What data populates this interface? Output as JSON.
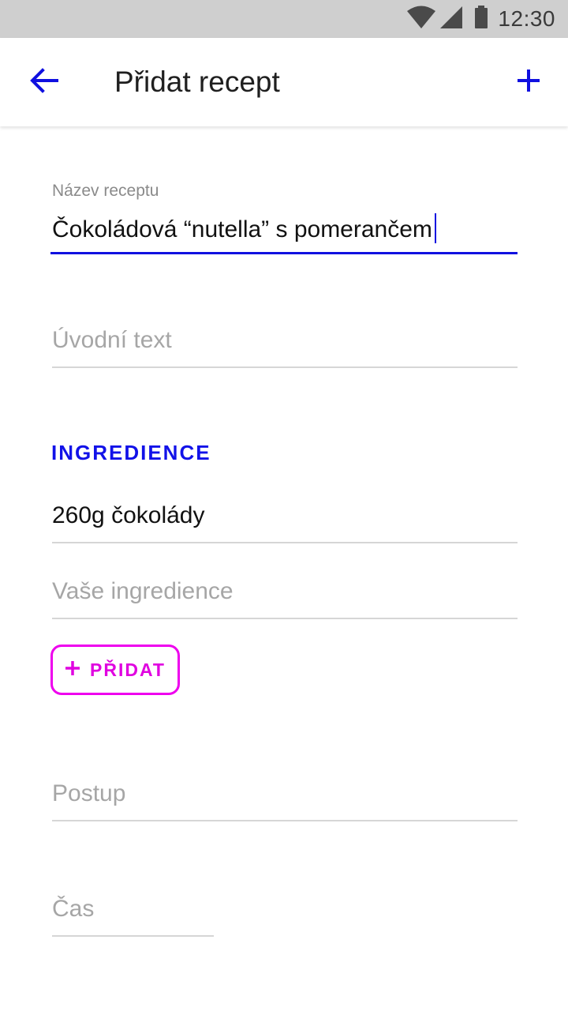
{
  "status_bar": {
    "time": "12:30",
    "icons": [
      "wifi-icon",
      "signal-icon",
      "battery-icon"
    ]
  },
  "app_bar": {
    "title": "Přidat recept",
    "back_icon": "arrow-left-icon",
    "add_icon": "plus-icon"
  },
  "form": {
    "recipe_name": {
      "label": "Název receptu",
      "value": "Čokoládová “nutella” s pomerančem"
    },
    "intro_text": {
      "placeholder": "Úvodní text"
    },
    "ingredients": {
      "section_title": "INGREDIENCE",
      "items": [
        "260g čokolády"
      ],
      "new_placeholder": "Vaše ingredience",
      "add_button_label": "PŘIDAT"
    },
    "procedure": {
      "placeholder": "Postup"
    },
    "time": {
      "placeholder": "Čas"
    }
  },
  "colors": {
    "accent": "#1010e0",
    "add_chip": "#ee00ee",
    "status_bar": "#cfcfcf"
  }
}
